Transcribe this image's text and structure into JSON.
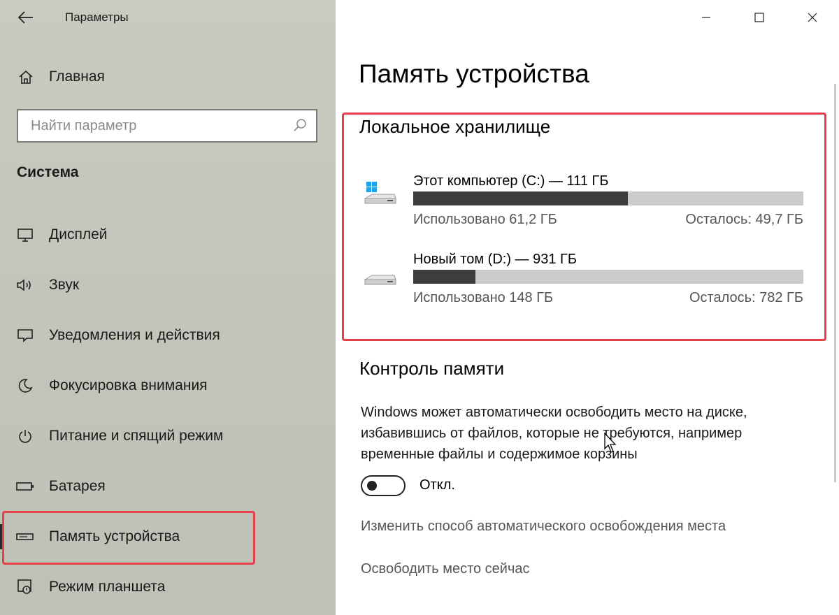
{
  "window": {
    "title": "Параметры"
  },
  "sidebar": {
    "home_label": "Главная",
    "search_placeholder": "Найти параметр",
    "section_label": "Система",
    "items": [
      {
        "label": "Дисплей",
        "icon": "monitor-icon"
      },
      {
        "label": "Звук",
        "icon": "speaker-icon"
      },
      {
        "label": "Уведомления и действия",
        "icon": "notification-icon"
      },
      {
        "label": "Фокусировка внимания",
        "icon": "moon-icon"
      },
      {
        "label": "Питание и спящий режим",
        "icon": "power-icon"
      },
      {
        "label": "Батарея",
        "icon": "battery-icon"
      },
      {
        "label": "Память устройства",
        "icon": "storage-icon",
        "active": true
      },
      {
        "label": "Режим планшета",
        "icon": "tablet-mode-icon"
      }
    ]
  },
  "main": {
    "page_title": "Память устройства",
    "local_storage": {
      "title": "Локальное хранилище",
      "drives": [
        {
          "name": "Этот компьютер (C:) — 111 ГБ",
          "used": "Использовано 61,2 ГБ",
          "free": "Осталось: 49,7 ГБ",
          "used_fraction": 0.551,
          "icon": "windows-drive-icon"
        },
        {
          "name": "Новый том (D:) — 931 ГБ",
          "used": "Использовано 148 ГБ",
          "free": "Осталось: 782 ГБ",
          "used_fraction": 0.159,
          "icon": "drive-icon"
        }
      ]
    },
    "storage_sense": {
      "title": "Контроль памяти",
      "description": "Windows может автоматически освободить место на диске, избавившись от файлов, которые не требуются, например временные файлы и содержимое корзины",
      "toggle_label": "Откл.",
      "toggle_on": false,
      "link_change": "Изменить способ автоматического освобождения места",
      "link_free_now": "Освободить место сейчас"
    }
  },
  "colors": {
    "highlight": "#e4404a",
    "bar_fill": "#3d3d3d",
    "bar_track": "#cccccc",
    "sidebar_bg": "#c3c6bb"
  }
}
